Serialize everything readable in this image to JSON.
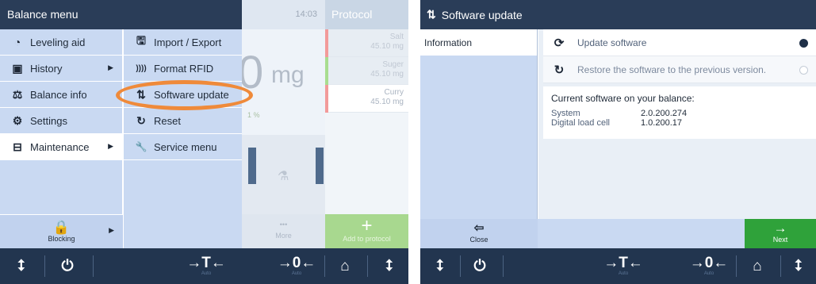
{
  "left": {
    "title": "Balance menu",
    "clock": "14:03",
    "weight_value": "0",
    "weight_unit": "mg",
    "percent": "1 %",
    "more_label": "More",
    "more_dots": "•••",
    "protocol": {
      "title": "Protocol",
      "items": [
        {
          "name": "Salt",
          "value": "45.10 mg",
          "color": "#f29a9a"
        },
        {
          "name": "Suger",
          "value": "45.10 mg",
          "color": "#a8dd90"
        },
        {
          "name": "Curry",
          "value": "45.10 mg",
          "color": "#f29a9a"
        }
      ],
      "add_label": "Add to protocol",
      "add_plus": "+"
    },
    "col1": [
      {
        "label": "Leveling aid",
        "icon": "leveling-icon",
        "glyph": "◔"
      },
      {
        "label": "History",
        "icon": "history-icon",
        "glyph": "▣"
      },
      {
        "label": "Balance info",
        "icon": "balance-info-icon",
        "glyph": "⚖"
      },
      {
        "label": "Settings",
        "icon": "settings-icon",
        "glyph": "⚙"
      },
      {
        "label": "Maintenance",
        "icon": "maintenance-icon",
        "glyph": "⊟"
      }
    ],
    "caret": "▶",
    "col2": [
      {
        "label": "Import / Export",
        "icon": "save-icon",
        "glyph": "🖫"
      },
      {
        "label": "Format RFID",
        "icon": "rfid-icon",
        "glyph": "))))"
      },
      {
        "label": "Software update",
        "icon": "software-update-icon",
        "glyph": "⇅"
      },
      {
        "label": "Reset",
        "icon": "reset-icon",
        "glyph": "↻"
      },
      {
        "label": "Service menu",
        "icon": "wrench-icon",
        "glyph": "🔧"
      }
    ],
    "blocking_label": "Blocking",
    "blocking_glyph": "🔒",
    "bottom": {
      "b1": "⭥",
      "b2": "⏻",
      "b3": "→T←",
      "b3_sub": "Auto",
      "b4": "→0←",
      "b4_sub": "Auto",
      "b5": "⌂",
      "b6": "⭥"
    }
  },
  "right": {
    "title": "Software update",
    "title_glyph": "⇅",
    "side_item": "Information",
    "options": [
      {
        "label": "Update software",
        "glyph": "⟳",
        "selected": true
      },
      {
        "label": "Restore the software to the previous version.",
        "glyph": "↻",
        "selected": false
      }
    ],
    "info_title": "Current software on your balance:",
    "info_rows": [
      {
        "key": "System",
        "value": "2.0.200.274"
      },
      {
        "key": "Digital load cell",
        "value": "1.0.200.17"
      }
    ],
    "close_label": "Close",
    "close_glyph": "⇦",
    "next_label": "Next",
    "next_glyph": "→",
    "bottom": {
      "b1": "⭥",
      "b2": "⏻",
      "b3": "→T←",
      "b3_sub": "Auto",
      "b4": "→0←",
      "b4_sub": "Auto",
      "b5": "⌂",
      "b6": "⭥"
    }
  }
}
